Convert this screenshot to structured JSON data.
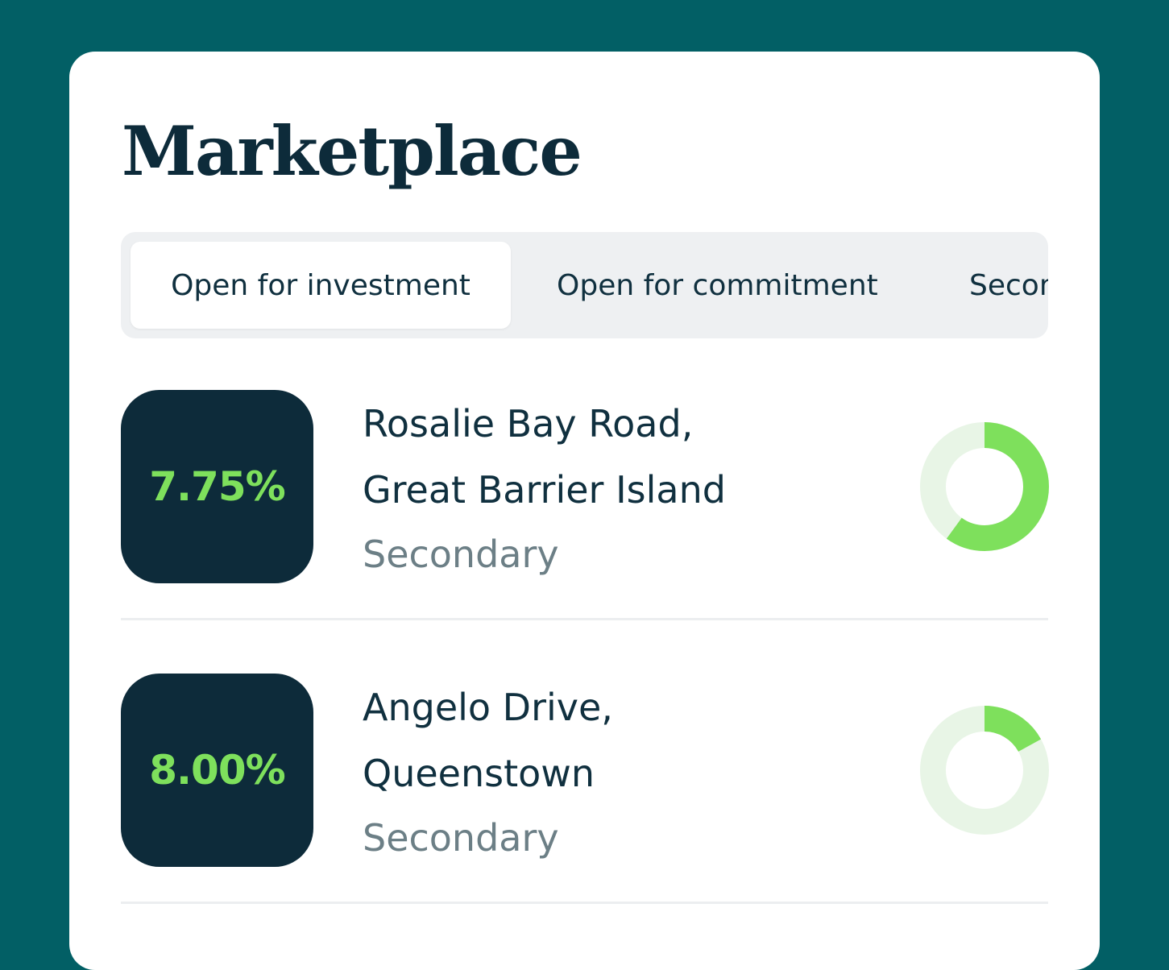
{
  "page_title": "Marketplace",
  "tabs": [
    {
      "label": "Open for investment",
      "active": true
    },
    {
      "label": "Open for commitment",
      "active": false
    },
    {
      "label": "Secondary",
      "active": false
    }
  ],
  "listings": [
    {
      "rate": "7.75%",
      "address_line1": "Rosalie Bay Road,",
      "address_line2": "Great Barrier Island",
      "market": "Secondary",
      "progress": 0.6
    },
    {
      "rate": "8.00%",
      "address_line1": "Angelo Drive,",
      "address_line2": "Queenstown",
      "market": "Secondary",
      "progress": 0.17
    }
  ],
  "colors": {
    "background": "#025f65",
    "card": "#ffffff",
    "navy": "#0d2b3a",
    "accent_green": "#7ee05c",
    "ring_track": "#e8f5e6",
    "muted_text": "#6c7f86"
  }
}
